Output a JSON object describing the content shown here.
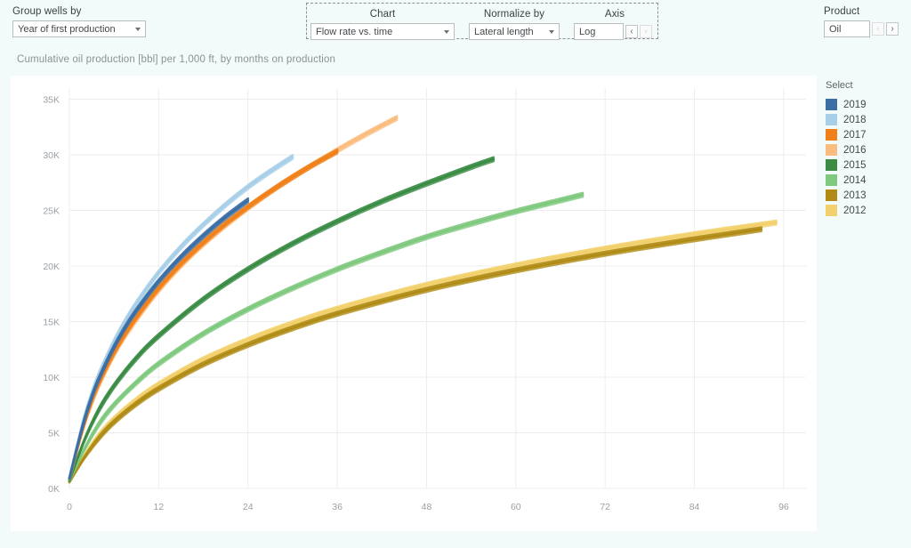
{
  "controls": {
    "group_wells_by": {
      "label": "Group wells by",
      "value": "Year of first production"
    },
    "chart": {
      "label": "Chart",
      "value": "Flow rate vs. time"
    },
    "normalize_by": {
      "label": "Normalize by",
      "value": "Lateral length"
    },
    "axis": {
      "label": "Axis",
      "value": "Log",
      "prev_label": "‹",
      "next_label": "›"
    },
    "product": {
      "label": "Product",
      "value": "Oil",
      "prev_label": "‹",
      "next_label": "›"
    }
  },
  "legend": {
    "title": "Select",
    "items": [
      {
        "label": "2019",
        "color": "#3b6ea5"
      },
      {
        "label": "2018",
        "color": "#a8cfe8"
      },
      {
        "label": "2017",
        "color": "#f0811a"
      },
      {
        "label": "2016",
        "color": "#fbbd7f"
      },
      {
        "label": "2015",
        "color": "#3a8c45"
      },
      {
        "label": "2014",
        "color": "#7fc97f"
      },
      {
        "label": "2013",
        "color": "#b08c17"
      },
      {
        "label": "2012",
        "color": "#f2d06b"
      }
    ]
  },
  "chart_data": {
    "type": "line",
    "title": "Cumulative oil production [bbl] per 1,000 ft, by months on production",
    "xlabel": "",
    "ylabel": "",
    "xlim": [
      0,
      99
    ],
    "ylim": [
      0,
      36000
    ],
    "xticks": [
      0,
      12,
      24,
      36,
      48,
      60,
      72,
      84,
      96
    ],
    "xticklabels": [
      "0",
      "12",
      "24",
      "36",
      "48",
      "60",
      "72",
      "84",
      "96"
    ],
    "yticks": [
      0,
      5000,
      10000,
      15000,
      20000,
      25000,
      30000,
      35000
    ],
    "yticklabels": [
      "0K",
      "5K",
      "10K",
      "15K",
      "20K",
      "25K",
      "30K",
      "35K"
    ],
    "grid": true,
    "legend_position": "right",
    "series": [
      {
        "name": "2019",
        "color": "#3b6ea5",
        "x": [
          0,
          1,
          2,
          3,
          4,
          6,
          8,
          10,
          12,
          15,
          18,
          21,
          24
        ],
        "values": [
          900,
          3600,
          6100,
          8200,
          9900,
          12700,
          15000,
          16900,
          18600,
          20800,
          22700,
          24400,
          25900
        ]
      },
      {
        "name": "2018",
        "color": "#a8cfe8",
        "x": [
          0,
          1,
          2,
          3,
          4,
          6,
          8,
          10,
          12,
          15,
          18,
          21,
          24,
          27,
          30
        ],
        "values": [
          950,
          3750,
          6350,
          8500,
          10300,
          13200,
          15600,
          17600,
          19400,
          21700,
          23700,
          25500,
          27100,
          28500,
          29800
        ]
      },
      {
        "name": "2017",
        "color": "#f0811a",
        "x": [
          0,
          1,
          2,
          3,
          4,
          6,
          8,
          10,
          12,
          15,
          18,
          21,
          24,
          27,
          30,
          33,
          36
        ],
        "values": [
          880,
          3450,
          5850,
          7850,
          9500,
          12200,
          14400,
          16300,
          18000,
          20200,
          22100,
          23800,
          25300,
          26700,
          28000,
          29200,
          30300
        ]
      },
      {
        "name": "2016",
        "color": "#fbbd7f",
        "x": [
          0,
          2,
          4,
          6,
          8,
          12,
          16,
          20,
          24,
          28,
          32,
          36,
          40,
          44
        ],
        "values": [
          860,
          5700,
          9300,
          12000,
          14200,
          17800,
          20700,
          23100,
          25200,
          27100,
          28800,
          30400,
          31900,
          33300
        ]
      },
      {
        "name": "2015",
        "color": "#3a8c45",
        "x": [
          0,
          2,
          4,
          6,
          9,
          12,
          18,
          24,
          30,
          36,
          42,
          48,
          54,
          57
        ],
        "values": [
          700,
          4300,
          7100,
          9200,
          11700,
          13700,
          17000,
          19700,
          22000,
          24000,
          25800,
          27400,
          28900,
          29600
        ]
      },
      {
        "name": "2014",
        "color": "#7fc97f",
        "x": [
          0,
          2,
          4,
          6,
          9,
          12,
          18,
          24,
          30,
          36,
          42,
          48,
          54,
          60,
          66,
          69
        ],
        "values": [
          650,
          3500,
          5800,
          7500,
          9500,
          11200,
          13900,
          16100,
          18000,
          19700,
          21200,
          22600,
          23800,
          24900,
          25900,
          26400
        ]
      },
      {
        "name": "2013",
        "color": "#b08c17",
        "x": [
          0,
          2,
          4,
          6,
          9,
          12,
          18,
          24,
          30,
          36,
          48,
          60,
          72,
          84,
          93
        ],
        "values": [
          560,
          2750,
          4550,
          5950,
          7600,
          8950,
          11150,
          12900,
          14400,
          15700,
          17850,
          19600,
          21100,
          22400,
          23300
        ]
      },
      {
        "name": "2012",
        "color": "#f2d06b",
        "x": [
          0,
          2,
          4,
          6,
          9,
          12,
          18,
          24,
          30,
          36,
          48,
          60,
          72,
          84,
          95
        ],
        "values": [
          590,
          2900,
          4800,
          6250,
          7950,
          9350,
          11600,
          13350,
          14850,
          16150,
          18300,
          20050,
          21550,
          22850,
          23900
        ]
      }
    ]
  }
}
